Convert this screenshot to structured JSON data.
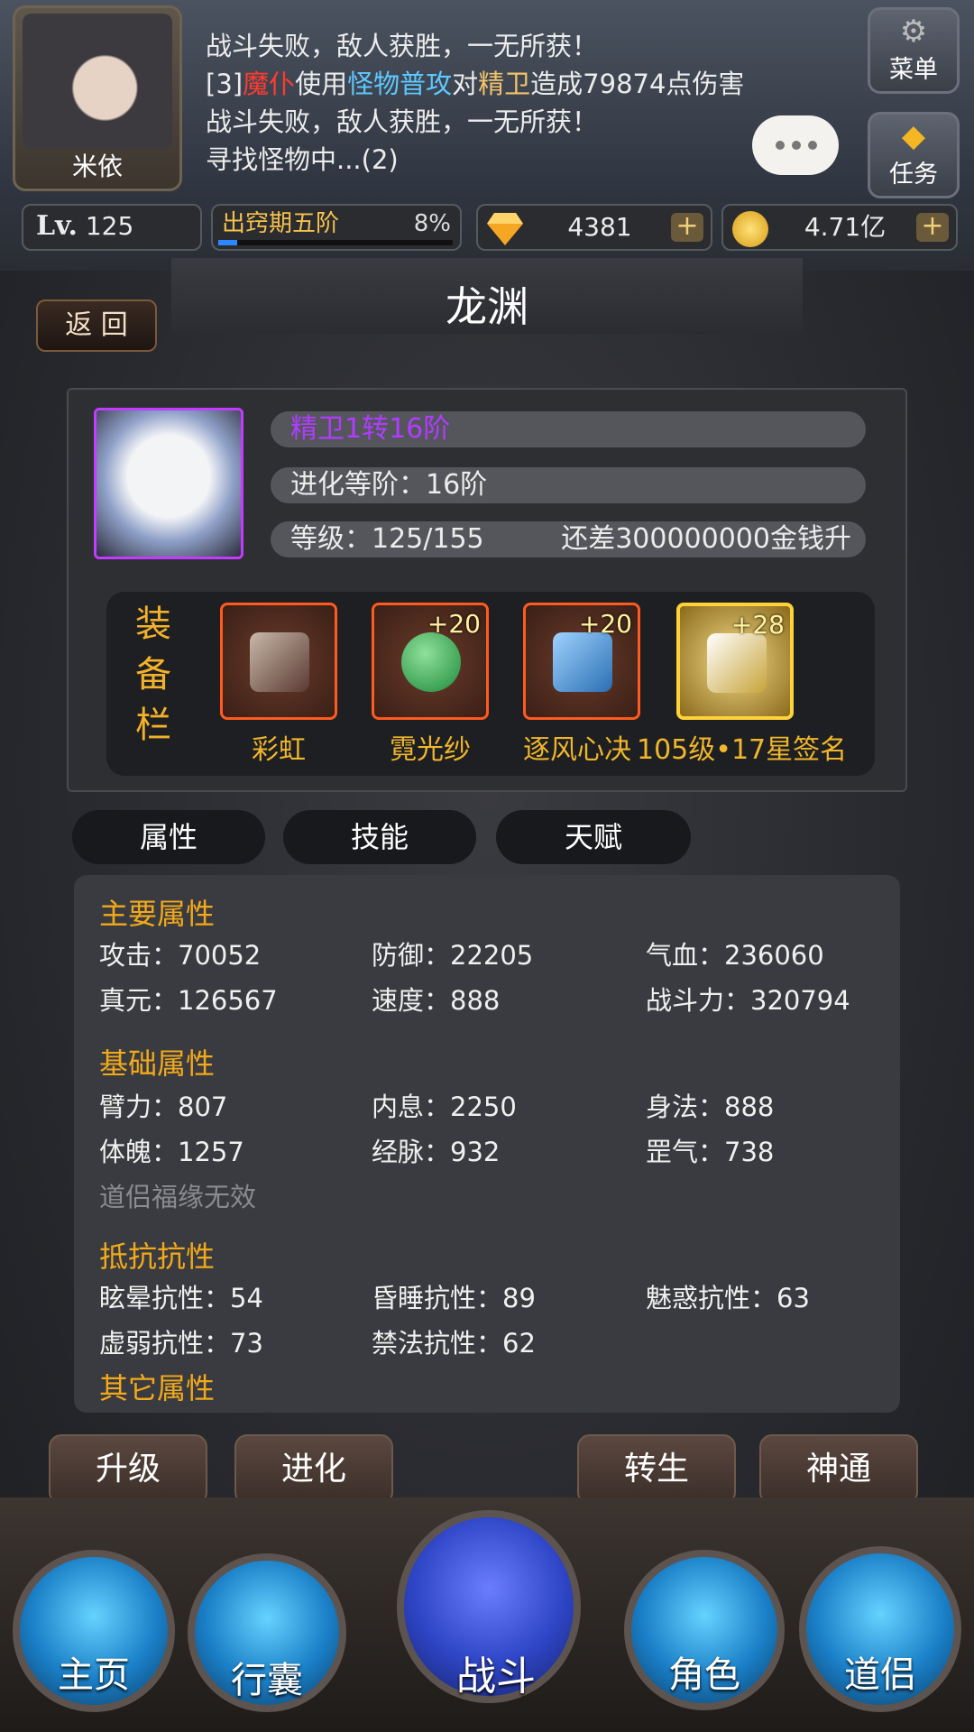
{
  "header": {
    "player_name": "米依",
    "battle_log": [
      {
        "parts": [
          {
            "t": "战斗失败，敌人获胜，一无所获！",
            "c": ""
          }
        ]
      },
      {
        "parts": [
          {
            "t": "[3]",
            "c": ""
          },
          {
            "t": "魔仆",
            "c": "red"
          },
          {
            "t": "使用",
            "c": ""
          },
          {
            "t": "怪物普攻",
            "c": "cyan"
          },
          {
            "t": "对",
            "c": ""
          },
          {
            "t": "精卫",
            "c": "yel"
          },
          {
            "t": "造成79874点伤害",
            "c": ""
          }
        ]
      },
      {
        "parts": [
          {
            "t": "战斗失败，敌人获胜，一无所获！",
            "c": ""
          }
        ]
      },
      {
        "parts": [
          {
            "t": "寻找怪物中...(2)",
            "c": ""
          }
        ]
      }
    ],
    "menu_label": "菜单",
    "task_label": "任务",
    "level_prefix": "Lv.",
    "level_value": "125",
    "realm": "出窍期五阶",
    "realm_progress_text": "8%",
    "realm_progress": 0.08,
    "gems": "4381",
    "gold": "4.71亿",
    "plus_symbol": "+"
  },
  "page": {
    "back_label": "返 回",
    "title": "龙渊"
  },
  "pet": {
    "name": "精卫1转16阶",
    "evolution": "进化等阶：16阶",
    "level": "等级：125/155",
    "upgrade_cost": "还差300000000金钱升"
  },
  "equipment": {
    "label": [
      "装",
      "备",
      "栏"
    ],
    "slots": [
      {
        "name": "彩虹",
        "plus": ""
      },
      {
        "name": "霓光纱",
        "plus": "+20"
      },
      {
        "name": "逐风心决",
        "plus": "+20"
      },
      {
        "name": "105级•17星签名",
        "plus": "+28"
      }
    ]
  },
  "tabs": [
    "属性",
    "技能",
    "天赋"
  ],
  "attributes": {
    "main_title": "主要属性",
    "main": [
      "攻击：70052",
      "防御：22205",
      "气血：236060",
      "真元：126567",
      "速度：888",
      "战斗力：320794"
    ],
    "base_title": "基础属性",
    "base": [
      "臂力：807",
      "内息：2250",
      "身法：888",
      "体魄：1257",
      "经脉：932",
      "罡气：738"
    ],
    "base_note": "道侣福缘无效",
    "resist_title": "抵抗抗性",
    "resist": [
      "眩晕抗性：54",
      "昏睡抗性：89",
      "魅惑抗性：63",
      "虚弱抗性：73",
      "禁法抗性：62"
    ],
    "other_title": "其它属性"
  },
  "actions": [
    "升级",
    "进化",
    "转生",
    "神通"
  ],
  "nav": [
    "主页",
    "行囊",
    "战斗",
    "角色",
    "道侣"
  ],
  "colors": {
    "accent_gold": "#f2aa1a",
    "pet_name": "#b13cff",
    "slot_red": "#ff5a1f",
    "slot_gold": "#ffd23a"
  }
}
